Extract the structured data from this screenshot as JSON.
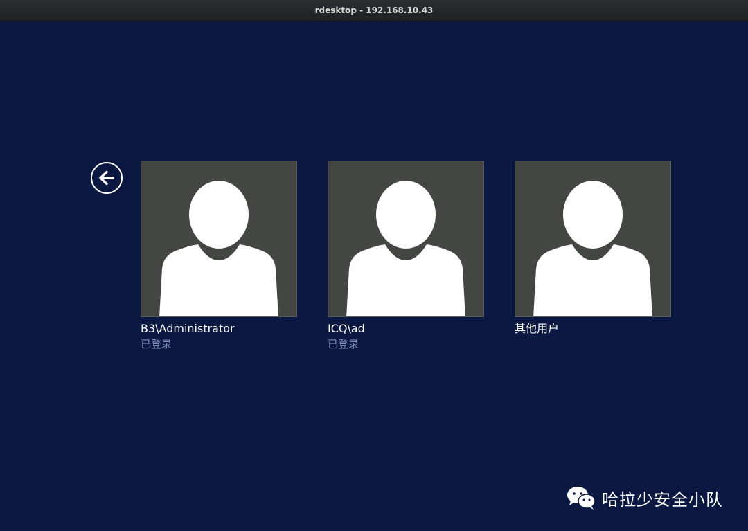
{
  "window": {
    "title": "rdesktop - 192.168.10.43"
  },
  "login": {
    "users": [
      {
        "name": "B3\\Administrator",
        "status": "已登录"
      },
      {
        "name": "ICQ\\ad",
        "status": "已登录"
      },
      {
        "name": "其他用户",
        "status": ""
      }
    ]
  },
  "watermark": {
    "text": "哈拉少安全小队",
    "icon": "wechat-icon"
  },
  "colors": {
    "background": "#0a1842",
    "tile": "#434643",
    "status_text": "#7a8bb8"
  }
}
